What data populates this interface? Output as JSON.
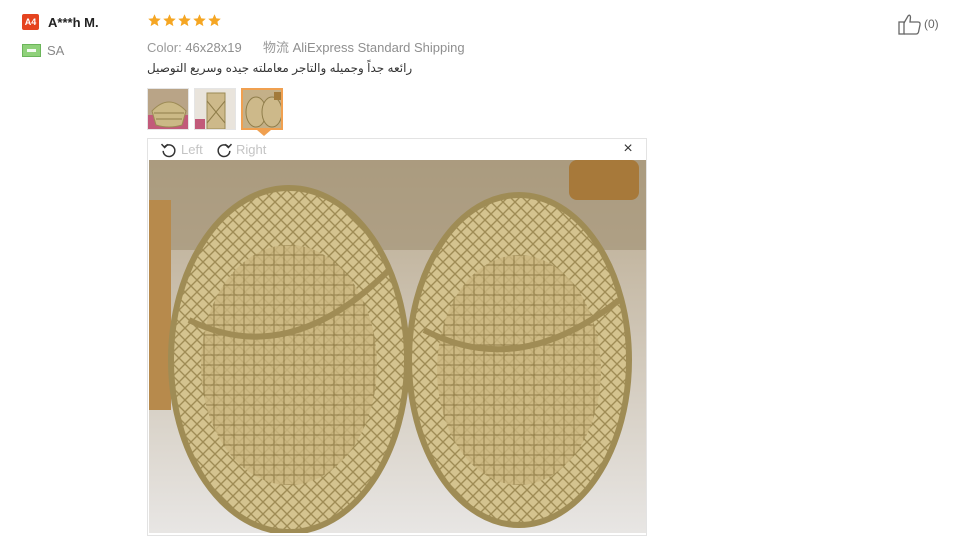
{
  "reviewer": {
    "avatar_initials": "A4",
    "name": "A***h M.",
    "country": "SA",
    "flag_icon": "flag-icon"
  },
  "rating": {
    "stars": 5,
    "max": 5,
    "star_color": "#f5a623"
  },
  "order_info": {
    "color_label": "Color:",
    "color_value": "46x28x19",
    "shipping_label": "物流",
    "shipping_value": "AliExpress Standard Shipping"
  },
  "review": {
    "text": "رائعه جداً وجميله والتاجر معاملته جيده وسريع التوصيل"
  },
  "thumbnails": [
    {
      "name": "thumb-1",
      "active": false
    },
    {
      "name": "thumb-2",
      "active": false
    },
    {
      "name": "thumb-3",
      "active": true
    }
  ],
  "viewer": {
    "rotate_left_label": "Left",
    "rotate_right_label": "Right",
    "close_glyph": "×"
  },
  "helpful": {
    "count": "(0)"
  },
  "colors": {
    "avatar_bg": "#e5431f",
    "accent_border": "#f0a050",
    "basket_tone": "#c8b27a"
  }
}
